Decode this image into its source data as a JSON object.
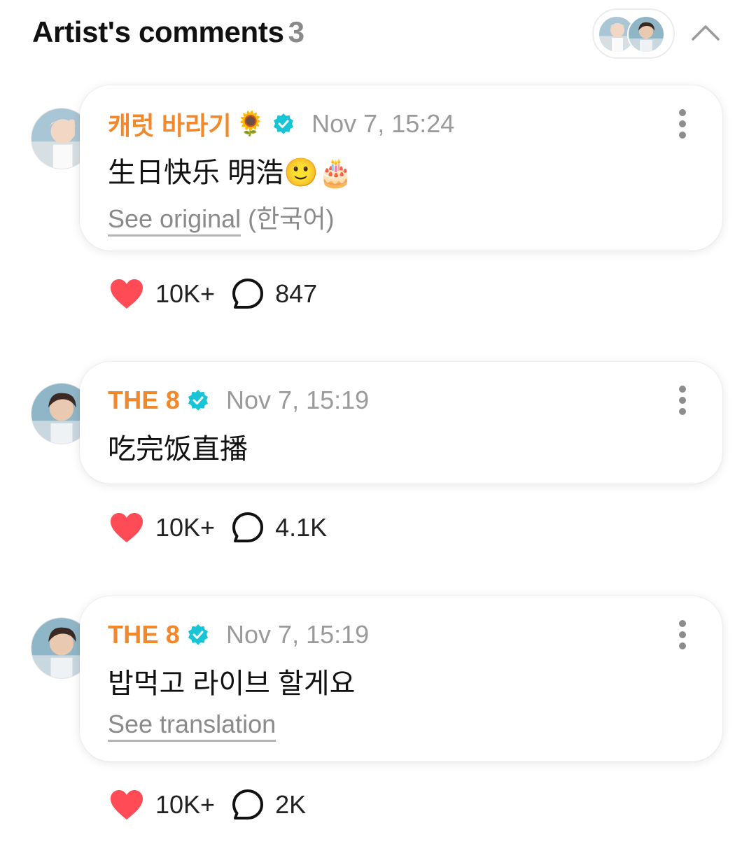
{
  "header": {
    "title": "Artist's comments",
    "count": "3"
  },
  "comments": [
    {
      "author": "캐럿 바라기",
      "author_emoji": "🌻",
      "time": "Nov 7, 15:24",
      "text": "生日快乐 明浩🙂🎂",
      "link_label": "See original",
      "link_suffix": "(한국어)",
      "likes": "10K+",
      "replies": "847"
    },
    {
      "author": "THE 8",
      "time": "Nov 7, 15:19",
      "text": "吃完饭直播",
      "likes": "10K+",
      "replies": "4.1K"
    },
    {
      "author": "THE 8",
      "time": "Nov 7, 15:19",
      "text": "밥먹고 라이브 할게요",
      "link_label": "See translation",
      "likes": "10K+",
      "replies": "2K"
    }
  ],
  "colors": {
    "author": "#f3882b",
    "verified": "#18c5d6",
    "heart": "#ff4b55",
    "muted": "#9a9a9a"
  },
  "icons": [
    "chevron-up-icon",
    "verified-badge-icon",
    "more-vertical-icon",
    "heart-icon",
    "comment-bubble-icon"
  ]
}
